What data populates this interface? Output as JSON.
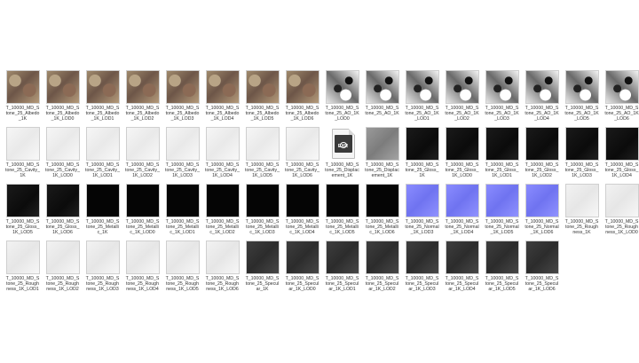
{
  "files": [
    {
      "name": "T_10000_MD_Stone_25_Albedo_1K",
      "kind": "albedo"
    },
    {
      "name": "T_10000_MD_Stone_25_Albedo_1K_LOD0",
      "kind": "albedo"
    },
    {
      "name": "T_10000_MD_Stone_25_Albedo_1K_LOD1",
      "kind": "albedo"
    },
    {
      "name": "T_10000_MD_Stone_25_Albedo_1K_LOD2",
      "kind": "albedo"
    },
    {
      "name": "T_10000_MD_Stone_25_Albedo_1K_LOD3",
      "kind": "albedo"
    },
    {
      "name": "T_10000_MD_Stone_25_Albedo_1K_LOD4",
      "kind": "albedo"
    },
    {
      "name": "T_10000_MD_Stone_25_Albedo_1K_LOD5",
      "kind": "albedo"
    },
    {
      "name": "T_10000_MD_Stone_25_Albedo_1K_LOD6",
      "kind": "albedo"
    },
    {
      "name": "T_10000_MD_Stone_25_AO_1K_LOD0",
      "kind": "ao"
    },
    {
      "name": "T_10000_MD_Stone_25_AO_1K",
      "kind": "ao"
    },
    {
      "name": "T_10000_MD_Stone_25_AO_1K_LOD1",
      "kind": "ao"
    },
    {
      "name": "T_10000_MD_Stone_25_AO_1K_LOD2",
      "kind": "ao"
    },
    {
      "name": "T_10000_MD_Stone_25_AO_1K_LOD3",
      "kind": "ao"
    },
    {
      "name": "T_10000_MD_Stone_25_AO_1K_LOD4",
      "kind": "ao"
    },
    {
      "name": "T_10000_MD_Stone_25_AO_1K_LOD5",
      "kind": "ao"
    },
    {
      "name": "T_10000_MD_Stone_25_AO_1K_LOD6",
      "kind": "ao"
    },
    {
      "name": "T_10000_MD_Stone_25_Cavity_1K",
      "kind": "cavity"
    },
    {
      "name": "T_10000_MD_Stone_25_Cavity_1K_LOD0",
      "kind": "cavity"
    },
    {
      "name": "T_10000_MD_Stone_25_Cavity_1K_LOD1",
      "kind": "cavity"
    },
    {
      "name": "T_10000_MD_Stone_25_Cavity_1K_LOD2",
      "kind": "cavity"
    },
    {
      "name": "T_10000_MD_Stone_25_Cavity_1K_LOD3",
      "kind": "cavity"
    },
    {
      "name": "T_10000_MD_Stone_25_Cavity_1K_LOD4",
      "kind": "cavity"
    },
    {
      "name": "T_10000_MD_Stone_25_Cavity_1K_LOD5",
      "kind": "cavity"
    },
    {
      "name": "T_10000_MD_Stone_25_Cavity_1K_LOD6",
      "kind": "cavity"
    },
    {
      "name": "T_10000_MD_Stone_25_Displacement_1K",
      "kind": "exr"
    },
    {
      "name": "T_10000_MD_Stone_25_Displacement_1K",
      "kind": "disp"
    },
    {
      "name": "T_10000_MD_Stone_25_Gloss_1K",
      "kind": "gloss-dark"
    },
    {
      "name": "T_10000_MD_Stone_25_Gloss_1K_LOD0",
      "kind": "gloss-dark"
    },
    {
      "name": "T_10000_MD_Stone_25_Gloss_1K_LOD1",
      "kind": "gloss-dark"
    },
    {
      "name": "T_10000_MD_Stone_25_Gloss_1K_LOD2",
      "kind": "gloss-dark"
    },
    {
      "name": "T_10000_MD_Stone_25_Gloss_1K_LOD3",
      "kind": "gloss-dark"
    },
    {
      "name": "T_10000_MD_Stone_25_Gloss_1K_LOD4",
      "kind": "gloss-dark"
    },
    {
      "name": "T_10000_MD_Stone_25_Gloss_1K_LOD5",
      "kind": "gloss-dark"
    },
    {
      "name": "T_10000_MD_Stone_25_Gloss_1K_LOD6",
      "kind": "gloss-dark"
    },
    {
      "name": "T_10000_MD_Stone_25_Metallic_1K",
      "kind": "metallic"
    },
    {
      "name": "T_10000_MD_Stone_25_Metallic_1K_LOD0",
      "kind": "metallic"
    },
    {
      "name": "T_10000_MD_Stone_25_Metallic_1K_LOD1",
      "kind": "metallic"
    },
    {
      "name": "T_10000_MD_Stone_25_Metallic_1K_LOD2",
      "kind": "metallic"
    },
    {
      "name": "T_10000_MD_Stone_25_Metallic_1K_LOD3",
      "kind": "metallic"
    },
    {
      "name": "T_10000_MD_Stone_25_Metallic_1K_LOD4",
      "kind": "metallic"
    },
    {
      "name": "T_10000_MD_Stone_25_Metallic_1K_LOD5",
      "kind": "metallic"
    },
    {
      "name": "T_10000_MD_Stone_25_Metallic_1K_LOD6",
      "kind": "metallic"
    },
    {
      "name": "T_10000_MD_Stone_25_Normal_1K_LOD3",
      "kind": "normal"
    },
    {
      "name": "T_10000_MD_Stone_25_Normal_1K_LOD4",
      "kind": "normal"
    },
    {
      "name": "T_10000_MD_Stone_25_Normal_1K_LOD5",
      "kind": "normal"
    },
    {
      "name": "T_10000_MD_Stone_25_Normal_1K_LOD6",
      "kind": "normal"
    },
    {
      "name": "T_10000_MD_Stone_25_Roughness_1K",
      "kind": "rough"
    },
    {
      "name": "T_10000_MD_Stone_25_Roughness_1K_LOD0",
      "kind": "rough"
    },
    {
      "name": "T_10000_MD_Stone_25_Roughness_1K_LOD1",
      "kind": "rough"
    },
    {
      "name": "T_10000_MD_Stone_25_Roughness_1K_LOD2",
      "kind": "rough"
    },
    {
      "name": "T_10000_MD_Stone_25_Roughness_1K_LOD3",
      "kind": "rough"
    },
    {
      "name": "T_10000_MD_Stone_25_Roughness_1K_LOD4",
      "kind": "rough"
    },
    {
      "name": "T_10000_MD_Stone_25_Roughness_1K_LOD5",
      "kind": "rough"
    },
    {
      "name": "T_10000_MD_Stone_25_Roughness_1K_LOD6",
      "kind": "rough"
    },
    {
      "name": "T_10000_MD_Stone_25_Specular_1K",
      "kind": "spec"
    },
    {
      "name": "T_10000_MD_Stone_25_Specular_1K_LOD0",
      "kind": "spec"
    },
    {
      "name": "T_10000_MD_Stone_25_Specular_1K_LOD1",
      "kind": "spec"
    },
    {
      "name": "T_10000_MD_Stone_25_Specular_1K_LOD2",
      "kind": "spec"
    },
    {
      "name": "T_10000_MD_Stone_25_Specular_1K_LOD3",
      "kind": "spec"
    },
    {
      "name": "T_10000_MD_Stone_25_Specular_1K_LOD4",
      "kind": "spec"
    },
    {
      "name": "T_10000_MD_Stone_25_Specular_1K_LOD5",
      "kind": "spec"
    },
    {
      "name": "T_10000_MD_Stone_25_Specular_1K_LOD6",
      "kind": "spec"
    }
  ],
  "exr_badge_label": "EXR"
}
